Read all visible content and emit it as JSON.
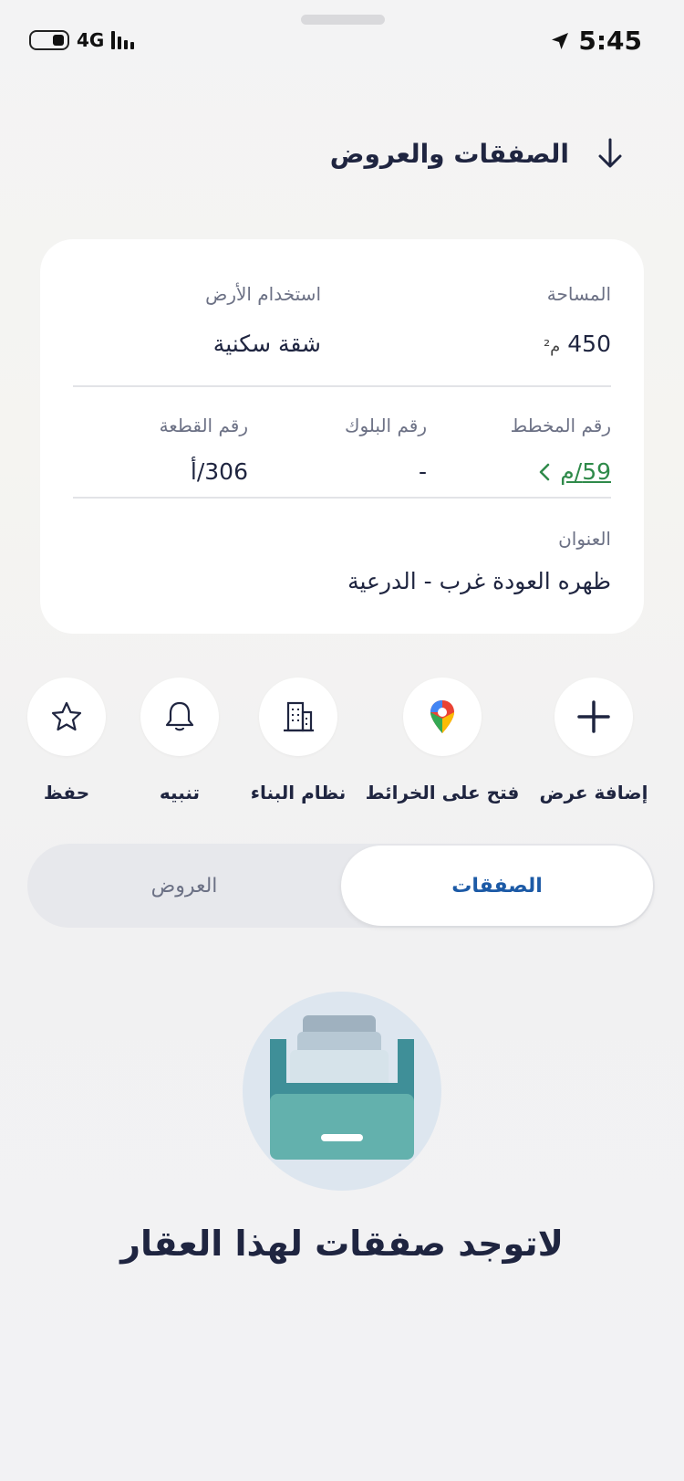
{
  "status_bar": {
    "time": "5:45",
    "network": "4G"
  },
  "header": {
    "title": "الصفقات والعروض"
  },
  "card": {
    "area": {
      "label": "المساحة",
      "value": "450",
      "unit": "م²"
    },
    "land_use": {
      "label": "استخدام الأرض",
      "value": "شقة سكنية"
    },
    "plan_number": {
      "label": "رقم المخطط",
      "value": "59/م"
    },
    "block_number": {
      "label": "رقم البلوك",
      "value": "-"
    },
    "plot_number": {
      "label": "رقم القطعة",
      "value": "306/أ"
    },
    "address": {
      "label": "العنوان",
      "value": "ظهره العودة غرب - الدرعية"
    }
  },
  "actions": [
    {
      "label": "إضافة عرض",
      "icon": "plus-icon"
    },
    {
      "label": "فتح على الخرائط",
      "icon": "map-pin-icon"
    },
    {
      "label": "نظام البناء",
      "icon": "building-icon"
    },
    {
      "label": "تنبيه",
      "icon": "bell-icon"
    },
    {
      "label": "حفظ",
      "icon": "star-icon"
    }
  ],
  "tabs": {
    "deals": "الصفقات",
    "offers": "العروض",
    "active": "deals"
  },
  "empty_state": {
    "message": "لاتوجد صفقات لهذا العقار"
  },
  "colors": {
    "accent": "#1c5aa6",
    "link": "#2f8a4a",
    "text": "#1f2540"
  }
}
